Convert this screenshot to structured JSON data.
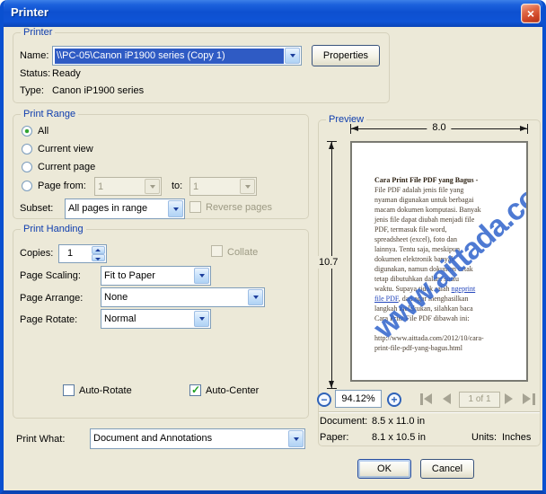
{
  "window": {
    "title": "Printer",
    "close_glyph": "×"
  },
  "colors": {
    "titlebar_blue": "#0D50D0",
    "dialog_bg": "#ECE9D8",
    "selection_blue": "#2F5BC4",
    "group_label_blue": "#0E3DAE",
    "close_red": "#CE4526",
    "check_green": "#21A121",
    "watermark_blue": "#3668CE"
  },
  "printer": {
    "group_label": "Printer",
    "name_label": "Name:",
    "name_value": "\\\\PC-05\\Canon iP1900 series (Copy 1)",
    "properties_label": "Properties",
    "status_label": "Status:",
    "status_value": "Ready",
    "type_label": "Type:",
    "type_value": "Canon iP1900 series"
  },
  "print_range": {
    "group_label": "Print Range",
    "options": [
      "All",
      "Current view",
      "Current page"
    ],
    "selected_option": "All",
    "page_from_label": "Page from:",
    "page_from_value": "1",
    "to_label": "to:",
    "to_value": "1",
    "subset_label": "Subset:",
    "subset_value": "All pages in range",
    "reverse_label": "Reverse pages"
  },
  "print_handling": {
    "group_label": "Print Handing",
    "copies_label": "Copies:",
    "copies_value": "1",
    "collate_label": "Collate",
    "page_scaling_label": "Page Scaling:",
    "page_scaling_value": "Fit to Paper",
    "page_arrange_label": "Page Arrange:",
    "page_arrange_value": "None",
    "page_rotate_label": "Page Rotate:",
    "page_rotate_value": "Normal",
    "auto_rotate_label": "Auto-Rotate",
    "auto_rotate_checked": false,
    "auto_center_label": "Auto-Center",
    "auto_center_checked": true
  },
  "print_what": {
    "label": "Print What:",
    "value": "Document and Annotations"
  },
  "preview": {
    "group_label": "Preview",
    "width_dim": "8.0",
    "height_dim": "10.7",
    "zoom_value": "94.12%",
    "zoom_out_glyph": "−",
    "zoom_in_glyph": "+",
    "page_indicator": "1 of 1",
    "document_label": "Document:",
    "document_value": "8.5 x 11.0 in",
    "paper_label": "Paper:",
    "paper_value": "8.1 x 10.5 in",
    "units_label": "Units:",
    "units_value": "Inches",
    "watermark": "www.aittada.com",
    "page_lines": [
      [
        {
          "t": "Cara Print File PDF yang Bagus -",
          "b": true
        }
      ],
      [
        {
          "t": "File PDF adalah jenis file yang"
        }
      ],
      [
        {
          "t": "nyaman digunakan untuk berbagai"
        }
      ],
      [
        {
          "t": "macam dokumen komputasi. Banyak"
        }
      ],
      [
        {
          "t": "jenis file dapat diubah menjadi file"
        }
      ],
      [
        {
          "t": "PDF, termasuk file word,"
        }
      ],
      [
        {
          "t": "spreadsheet (excel), foto dan"
        }
      ],
      [
        {
          "t": "lainnya. Tentu saja, meskipun"
        }
      ],
      [
        {
          "t": "dokumen elektronik banyak"
        }
      ],
      [
        {
          "t": "digunakan, namun dokumen cetak"
        }
      ],
      [
        {
          "t": "tetap dibutuhkan dalam suatu"
        }
      ],
      [
        {
          "t": "waktu. Supaya tidak salah "
        },
        {
          "t": "ngeprint",
          "l": true
        }
      ],
      [
        {
          "t": "file PDF",
          "l": true
        },
        {
          "t": ", dan agar menghasilkan"
        }
      ],
      [
        {
          "t": "langkah melakukan, silahkan baca"
        }
      ],
      [
        {
          "t": "Cara Print File PDF dibawah ini:"
        }
      ],
      [
        {
          "t": " "
        }
      ],
      [
        {
          "t": "http://www.aittada.com/2012/10/cara-"
        }
      ],
      [
        {
          "t": "print-file-pdf-yang-bagus.html"
        }
      ]
    ]
  },
  "footer": {
    "ok_label": "OK",
    "cancel_label": "Cancel"
  }
}
